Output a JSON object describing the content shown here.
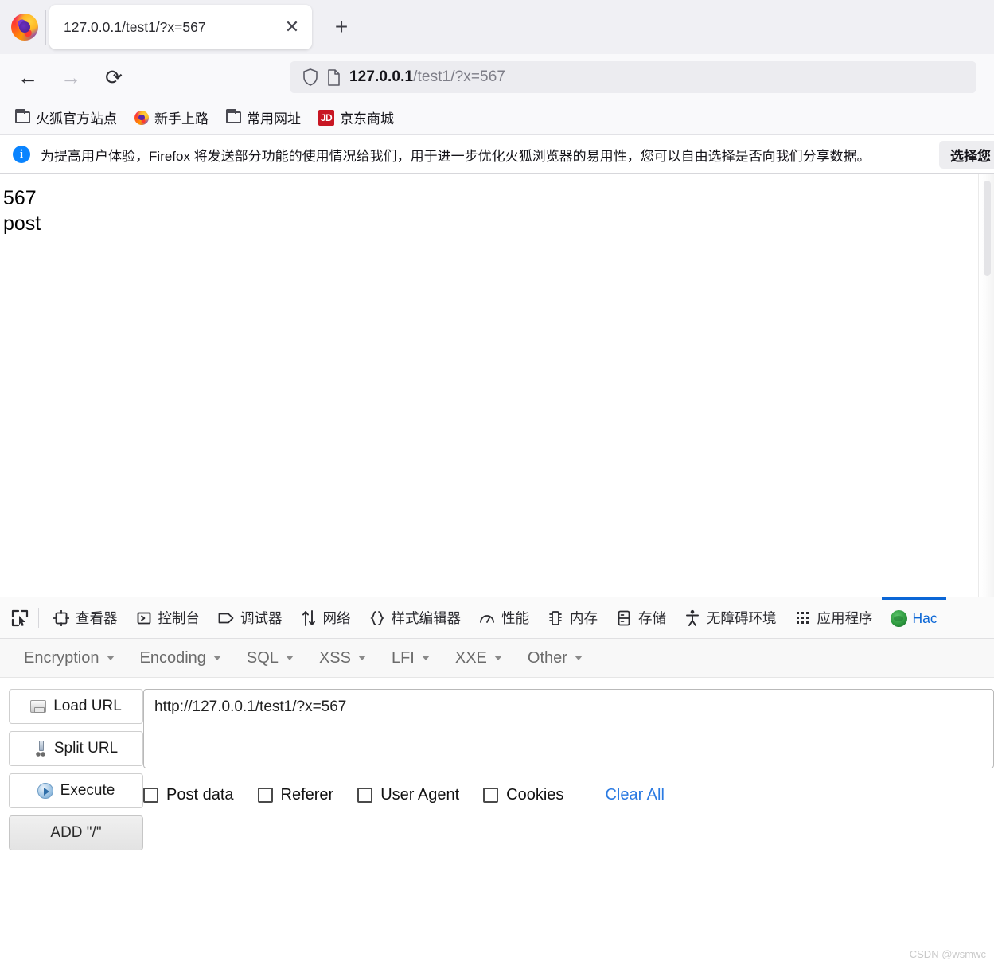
{
  "browser": {
    "logo_icon": "firefox-logo",
    "tab": {
      "title": "127.0.0.1/test1/?x=567",
      "close_icon": "close-icon"
    },
    "new_tab_icon": "plus-icon",
    "nav": {
      "back_icon": "arrow-left-icon",
      "forward_icon": "arrow-right-icon",
      "reload_icon": "reload-icon"
    },
    "urlbar": {
      "shield_icon": "shield-icon",
      "page_icon": "page-icon",
      "host": "127.0.0.1",
      "path": "/test1/?x=567"
    },
    "bookmarks": [
      {
        "label": "火狐官方站点",
        "icon": "folder-icon"
      },
      {
        "label": "新手上路",
        "icon": "firefox-icon"
      },
      {
        "label": "常用网址",
        "icon": "folder-icon"
      },
      {
        "label": "京东商城",
        "icon": "jd-icon",
        "icon_text": "JD"
      }
    ],
    "notification": {
      "info_icon": "info-icon",
      "info_glyph": "i",
      "message": "为提高用户体验，Firefox 将发送部分功能的使用情况给我们，用于进一步优化火狐浏览器的易用性，您可以自由选择是否向我们分享数据。",
      "button_label": "选择您"
    }
  },
  "page": {
    "lines": [
      "567",
      "post"
    ]
  },
  "devtools": {
    "picker_icon": "element-picker-icon",
    "tabs": [
      {
        "label": "查看器",
        "icon": "inspector-icon",
        "active": false
      },
      {
        "label": "控制台",
        "icon": "console-icon",
        "active": false
      },
      {
        "label": "调试器",
        "icon": "debugger-icon",
        "active": false
      },
      {
        "label": "网络",
        "icon": "network-icon",
        "active": false
      },
      {
        "label": "样式编辑器",
        "icon": "style-editor-icon",
        "active": false
      },
      {
        "label": "性能",
        "icon": "performance-icon",
        "active": false
      },
      {
        "label": "内存",
        "icon": "memory-icon",
        "active": false
      },
      {
        "label": "存储",
        "icon": "storage-icon",
        "active": false
      },
      {
        "label": "无障碍环境",
        "icon": "accessibility-icon",
        "active": false
      },
      {
        "label": "应用程序",
        "icon": "application-icon",
        "active": false
      },
      {
        "label": "Hac",
        "icon": "hackbar-icon",
        "active": true
      }
    ]
  },
  "hackbar": {
    "menu": [
      {
        "label": "Encryption"
      },
      {
        "label": "Encoding"
      },
      {
        "label": "SQL"
      },
      {
        "label": "XSS"
      },
      {
        "label": "LFI"
      },
      {
        "label": "XXE"
      },
      {
        "label": "Other"
      }
    ],
    "buttons": [
      {
        "label": "Load URL",
        "icon": "load-url-icon"
      },
      {
        "label": "Split URL",
        "icon": "split-url-icon"
      },
      {
        "label": "Execute",
        "icon": "execute-icon"
      },
      {
        "label": "ADD \"/\"",
        "icon": "none"
      }
    ],
    "url_value": "http://127.0.0.1/test1/?x=567",
    "options": [
      {
        "label": "Post data",
        "checked": false
      },
      {
        "label": "Referer",
        "checked": false
      },
      {
        "label": "User Agent",
        "checked": false
      },
      {
        "label": "Cookies",
        "checked": false
      }
    ],
    "clear_all_label": "Clear All",
    "accent_color": "#2a7ae2"
  },
  "watermark": "CSDN @wsmwc"
}
